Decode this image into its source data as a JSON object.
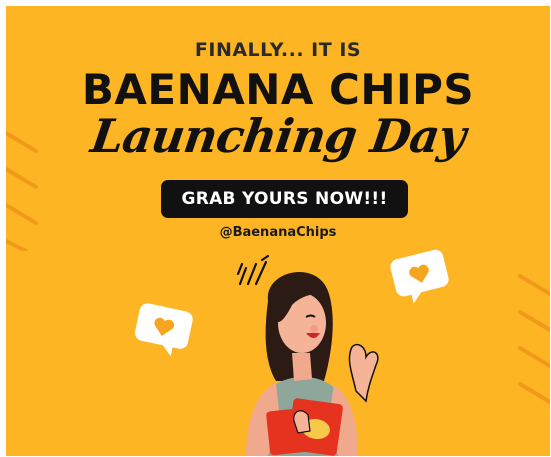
{
  "poster": {
    "kicker": "FINALLY... IT IS",
    "brand": "BAENANA CHIPS",
    "script_title": "Launching Day",
    "cta_label": "GRAB YOURS NOW!!!",
    "handle": "@BaenanaChips"
  },
  "colors": {
    "background": "#FDB524",
    "ink": "#111111",
    "button": "#111111",
    "button_text": "#FFFFFF",
    "chip_bag": "#E5331F"
  },
  "icons": [
    "heart-bubble-icon",
    "heart-bubble-icon",
    "excitement-lines-icon",
    "stripe-decoration"
  ]
}
